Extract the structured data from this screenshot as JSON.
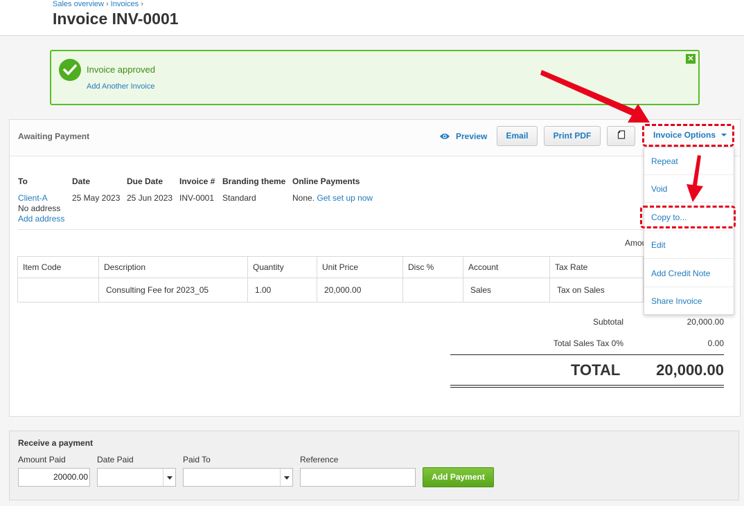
{
  "breadcrumb": {
    "item1": "Sales overview",
    "item2": "Invoices",
    "sep": "›"
  },
  "page_title": "Invoice INV-0001",
  "alert": {
    "message": "Invoice approved",
    "link": "Add Another Invoice",
    "close": "✕"
  },
  "toolbar": {
    "status": "Awaiting Payment",
    "preview": "Preview",
    "email": "Email",
    "print_pdf": "Print PDF",
    "options": "Invoice Options"
  },
  "details": {
    "to_label": "To",
    "to_client": "Client-A",
    "to_address": "No address",
    "to_add_address": "Add address",
    "date_label": "Date",
    "date_value": "25 May 2023",
    "due_label": "Due Date",
    "due_value": "25 Jun 2023",
    "invoice_label": "Invoice #",
    "invoice_value": "INV-0001",
    "branding_label": "Branding theme",
    "branding_value": "Standard",
    "online_label": "Online Payments",
    "online_value": "None.",
    "online_link": "Get set up now"
  },
  "amounts_cut": "Amou",
  "table": {
    "headers": [
      "Item Code",
      "Description",
      "Quantity",
      "Unit Price",
      "Disc %",
      "Account",
      "Tax Rate"
    ],
    "row": [
      "",
      "Consulting Fee for 2023_05",
      "1.00",
      "20,000.00",
      "",
      "Sales",
      "Tax on Sales"
    ]
  },
  "totals": {
    "subtotal_label": "Subtotal",
    "subtotal_value": "20,000.00",
    "tax_label": "Total Sales Tax 0%",
    "tax_value": "0.00",
    "total_label": "TOTAL",
    "total_value": "20,000.00"
  },
  "menu": {
    "items": [
      "Repeat",
      "Void",
      "Copy to...",
      "Edit",
      "Add Credit Note",
      "Share Invoice"
    ]
  },
  "payment": {
    "title": "Receive a payment",
    "amount_label": "Amount Paid",
    "amount_value": "20000.00",
    "date_label": "Date Paid",
    "date_value": "",
    "paid_to_label": "Paid To",
    "paid_to_value": "",
    "reference_label": "Reference",
    "reference_value": "",
    "add_button": "Add Payment"
  },
  "colors": {
    "accent": "#1f7bbf",
    "success": "#4eae1f",
    "annotation": "#e2001a"
  },
  "icons": [
    "check-icon",
    "close-icon",
    "eye-icon",
    "copy-icon",
    "caret-down-icon",
    "dropdown-arrow-icon"
  ]
}
